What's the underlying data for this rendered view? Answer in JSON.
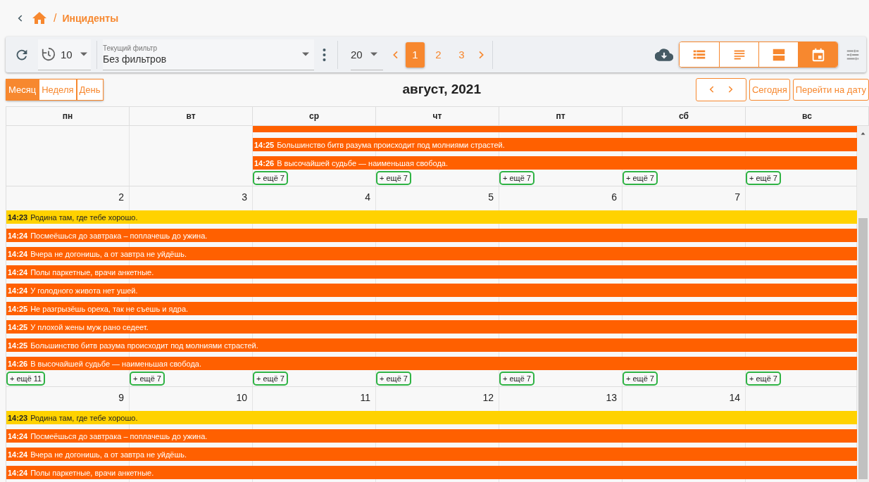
{
  "breadcrumb": {
    "separator": "/",
    "title": "Инциденты"
  },
  "toolbar": {
    "refresh_interval": "10",
    "filter": {
      "label": "Текущий фильтр",
      "value": "Без фильтров"
    },
    "page_size": "20",
    "pages": [
      {
        "label": "1",
        "selected": true
      },
      {
        "label": "2",
        "selected": false
      },
      {
        "label": "3",
        "selected": false
      }
    ],
    "views": [
      {
        "kind": "table",
        "selected": false
      },
      {
        "kind": "list",
        "selected": false
      },
      {
        "kind": "cards",
        "selected": false
      },
      {
        "kind": "calendar",
        "selected": true
      }
    ]
  },
  "calendar": {
    "modes": [
      {
        "label": "Месяц",
        "selected": true
      },
      {
        "label": "Неделя",
        "selected": false
      },
      {
        "label": "День",
        "selected": false
      }
    ],
    "title": "август, 2021",
    "today_button": "Сегодня",
    "goto_button": "Перейти на дату",
    "weekdays": [
      "пн",
      "вт",
      "ср",
      "чт",
      "пт",
      "сб",
      "вс"
    ],
    "weeks": [
      {
        "days": [
          {
            "selected": false
          },
          {
            "selected": false
          },
          {
            "selected": false,
            "clipped_event": {
              "color": "#ff6000"
            },
            "events": [
              {
                "time": "14:25",
                "text": "Большинство битв разума происходит под молниями страстей.",
                "color": "#ff6000"
              },
              {
                "time": "14:26",
                "text": "В высочайшей судьбе — наименьшая свобода.",
                "color": "#ff6000"
              }
            ],
            "more": "+ ещё 7"
          },
          {
            "selected": false,
            "more": "+ ещё 7"
          },
          {
            "selected": false,
            "more": "+ ещё 7"
          },
          {
            "selected": false,
            "more": "+ ещё 7"
          },
          {
            "selected": false,
            "more": "+ ещё 7"
          }
        ]
      },
      {
        "days": [
          {
            "selected": false,
            "date": "2",
            "events": [
              {
                "time": "14:23",
                "text": "Родина там, где тебе хорошо.",
                "color": "#ffd200"
              },
              {
                "time": "14:24",
                "text": "Посмеёшься до завтрака – поплачешь до ужина.",
                "color": "#ff6000"
              },
              {
                "time": "14:24",
                "text": "Вчера не догонишь, а от завтра не уйдёшь.",
                "color": "#ff6000"
              },
              {
                "time": "14:24",
                "text": "Полы паркетные, врачи анкетные.",
                "color": "#ff6000"
              },
              {
                "time": "14:24",
                "text": "У голодного живота нет ушей.",
                "color": "#ff6000"
              },
              {
                "time": "14:25",
                "text": "Не разгрызёшь ореха, так не съешь и ядра.",
                "color": "#ff6000"
              },
              {
                "time": "14:25",
                "text": "У плохой жены муж рано седеет.",
                "color": "#ff6000"
              },
              {
                "time": "14:25",
                "text": "Большинство битв разума происходит под молниями страстей.",
                "color": "#ff6000"
              },
              {
                "time": "14:26",
                "text": "В высочайшей судьбе — наименьшая свобода.",
                "color": "#ff6000"
              }
            ],
            "more": "+ ещё 11"
          },
          {
            "selected": false,
            "date": "3",
            "more": "+ ещё 7"
          },
          {
            "selected": false,
            "date": "4",
            "more": "+ ещё 7"
          },
          {
            "selected": false,
            "date": "5",
            "more": "+ ещё 7"
          },
          {
            "selected": false,
            "date": "6",
            "more": "+ ещё 7"
          },
          {
            "selected": false,
            "date": "7",
            "more": "+ ещё 7"
          },
          {
            "selected": false,
            "more": "+ ещё 7"
          }
        ]
      },
      {
        "days": [
          {
            "selected": false,
            "date": "9",
            "events": [
              {
                "time": "14:23",
                "text": "Родина там, где тебе хорошо.",
                "color": "#ffd200"
              },
              {
                "time": "14:24",
                "text": "Посмеёшься до завтрака – поплачешь до ужина.",
                "color": "#ff6000"
              },
              {
                "time": "14:24",
                "text": "Вчера не догонишь, а от завтра не уйдёшь.",
                "color": "#ff6000"
              },
              {
                "time": "14:24",
                "text": "Полы паркетные, врачи анкетные.",
                "color": "#ff6000"
              }
            ]
          },
          {
            "selected": false,
            "date": "10"
          },
          {
            "selected": false,
            "date": "11"
          },
          {
            "selected": false,
            "date": "12"
          },
          {
            "selected": false,
            "date": "13"
          },
          {
            "selected": false,
            "date": "14"
          },
          {
            "selected": false
          }
        ]
      }
    ]
  }
}
